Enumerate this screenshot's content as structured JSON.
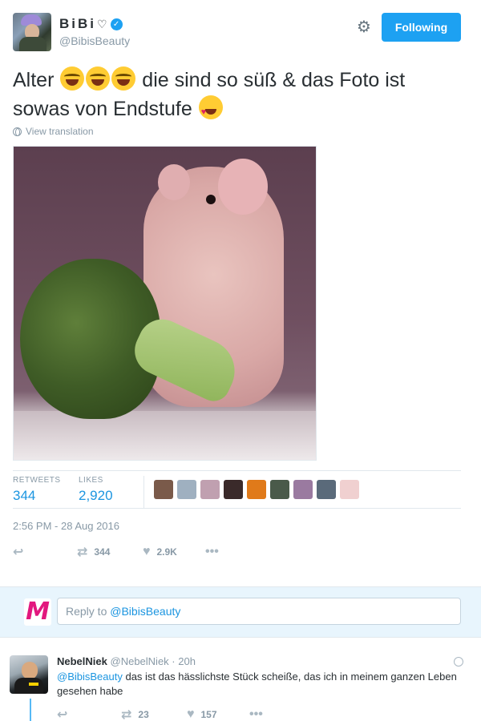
{
  "tweet": {
    "author": {
      "name": "BiBi",
      "name_suffix": "♡",
      "handle": "@BibisBeauty",
      "verified": true
    },
    "follow_button": "Following",
    "text_parts": [
      "Alter ",
      " die sind so süß & das Foto ist sowas von Endstufe "
    ],
    "emojis": [
      "face-with-tears-of-joy",
      "face-with-tears-of-joy",
      "face-with-tears-of-joy",
      "smiling-face-with-heart-eyes"
    ],
    "view_translation": "View translation",
    "stats": {
      "retweets_label": "RETWEETS",
      "retweets": "344",
      "likes_label": "LIKES",
      "likes": "2,920"
    },
    "liker_avatar_colors": [
      "#7a5a4a",
      "#9fb0c0",
      "#c0a0b0",
      "#3a2a2a",
      "#e07a1a",
      "#4a5a4a",
      "#9a7aa0",
      "#5a6a7a",
      "#f0d0d0"
    ],
    "timestamp": "2:56 PM - 28 Aug 2016",
    "actions": {
      "retweet_count": "344",
      "like_count": "2.9K"
    },
    "icons": [
      "reply-icon",
      "retweet-icon",
      "heart-icon",
      "more-icon",
      "gear-icon",
      "globe-icon"
    ]
  },
  "reply_box": {
    "placeholder_prefix": "Reply to ",
    "placeholder_mention": "@BibisBeauty",
    "avatar_letter": "M",
    "avatar_color": "#e2177e"
  },
  "reply": {
    "name": "NebelNiek",
    "handle": "@NebelNiek",
    "separator": "·",
    "time": "20h",
    "mention": "@BibisBeauty",
    "text": " das ist das hässlichste Stück scheiße, das ich in meinem ganzen Leben gesehen habe",
    "retweet_count": "23",
    "like_count": "157"
  },
  "colors": {
    "accent": "#1da1f2",
    "link": "#1b95e0",
    "muted": "#8899a6"
  }
}
